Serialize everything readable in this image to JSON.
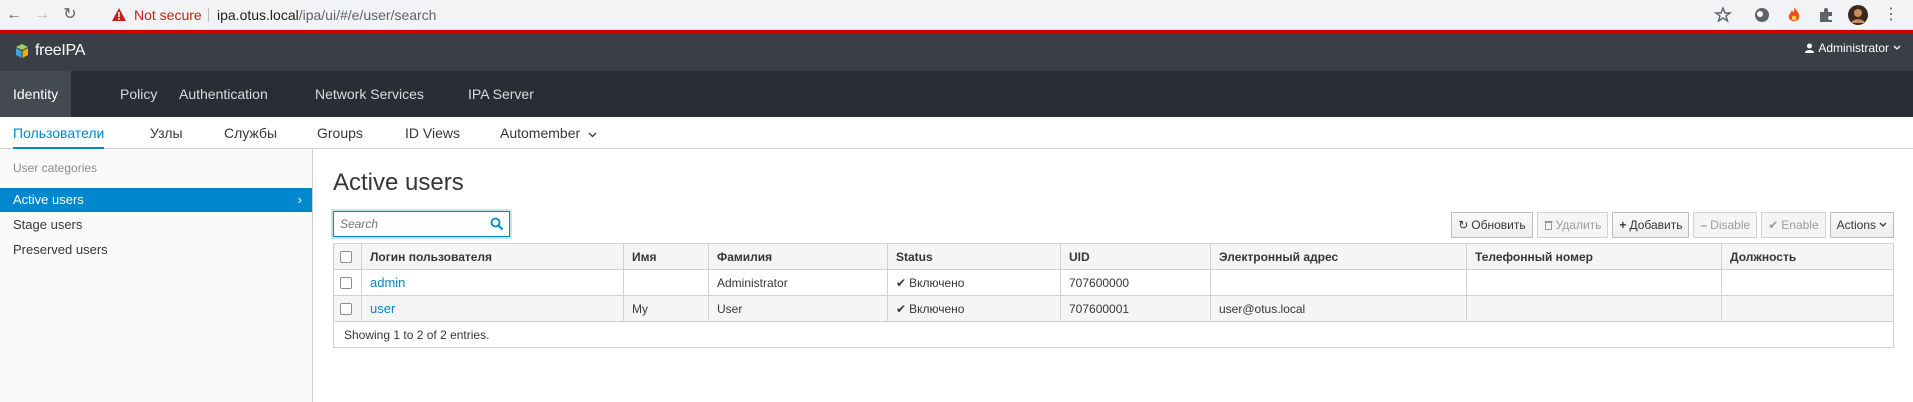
{
  "browser": {
    "security_label": "Not secure",
    "url_host": "ipa.otus.local",
    "url_path": "/ipa/ui/#/e/user/search"
  },
  "masthead": {
    "brand": "freeIPA",
    "user_label": "Administrator"
  },
  "primary_nav": [
    {
      "label": "Identity"
    },
    {
      "label": "Policy"
    },
    {
      "label": "Authentication"
    },
    {
      "label": "Network Services"
    },
    {
      "label": "IPA Server"
    }
  ],
  "secondary_nav": [
    {
      "label": "Пользователи"
    },
    {
      "label": "Узлы"
    },
    {
      "label": "Службы"
    },
    {
      "label": "Groups"
    },
    {
      "label": "ID Views"
    },
    {
      "label": "Automember"
    }
  ],
  "sidebar": {
    "category_label": "User categories",
    "items": [
      {
        "label": "Active users"
      },
      {
        "label": "Stage users"
      },
      {
        "label": "Preserved users"
      }
    ]
  },
  "main": {
    "title": "Active users",
    "search_placeholder": "Search",
    "buttons": {
      "refresh": "Обновить",
      "delete": "Удалить",
      "add": "Добавить",
      "disable": "Disable",
      "enable": "Enable",
      "actions": "Actions"
    },
    "table": {
      "columns": [
        "Логин пользователя",
        "Имя",
        "Фамилия",
        "Status",
        "UID",
        "Электронный адрес",
        "Телефонный номер",
        "Должность"
      ],
      "rows": [
        {
          "login": "admin",
          "first": "",
          "last": "Administrator",
          "status": "Включено",
          "uid": "707600000",
          "email": "",
          "phone": "",
          "title": ""
        },
        {
          "login": "user",
          "first": "My",
          "last": "User",
          "status": "Включено",
          "uid": "707600001",
          "email": "user@otus.local",
          "phone": "",
          "title": ""
        }
      ],
      "footer": "Showing 1 to 2 of 2 entries."
    }
  }
}
